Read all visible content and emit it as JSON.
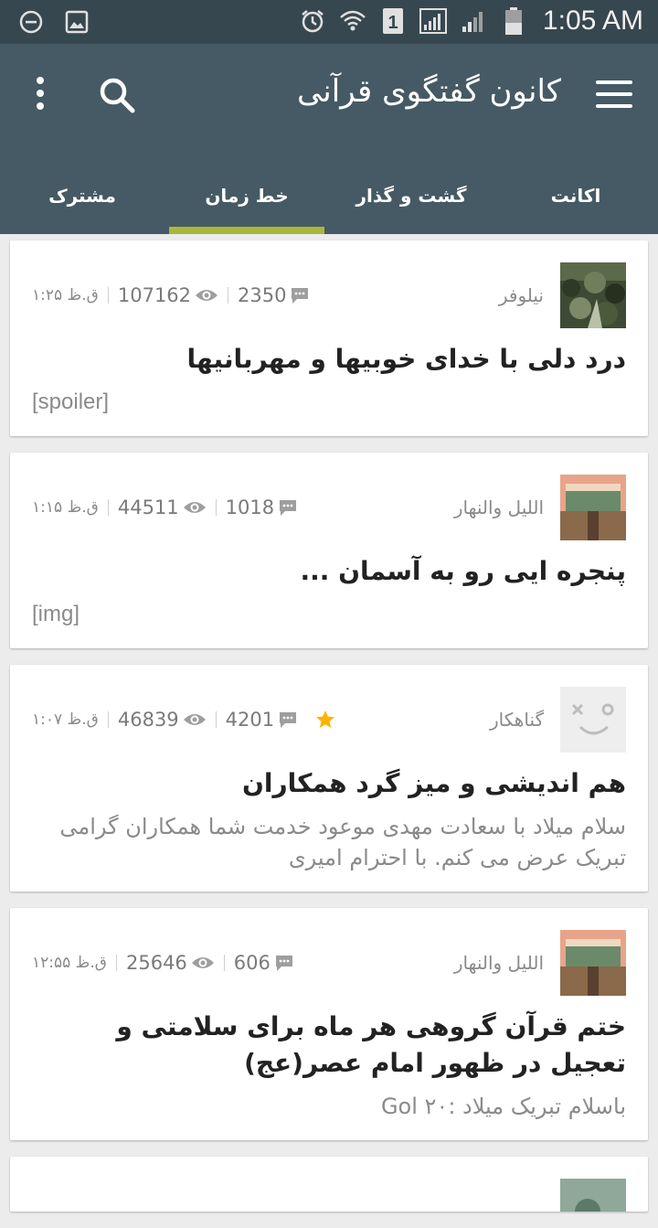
{
  "status_bar": {
    "time": "1:05 AM",
    "icons": [
      "do-not-disturb-icon",
      "gallery-icon",
      "alarm-icon",
      "wifi-icon",
      "sim-1-icon",
      "signal-icon",
      "signal-2-icon",
      "battery-icon"
    ]
  },
  "app_bar": {
    "title": "کانون گفتگوی قرآنی",
    "icons": [
      "menu-icon",
      "search-icon",
      "more-vert-icon"
    ],
    "tabs": [
      {
        "label": "اکانت",
        "active": false
      },
      {
        "label": "گشت و گذار",
        "active": false
      },
      {
        "label": "خط زمان",
        "active": true
      },
      {
        "label": "مشترک",
        "active": false
      }
    ],
    "colors": {
      "status": "#37474f",
      "bar": "#455a64",
      "indicator": "#a8b83a"
    }
  },
  "posts": [
    {
      "author": "نیلوفر",
      "comments": "2350",
      "views": "107162",
      "time": "۱:۲۵ ق.ظ",
      "title": "درد دلی با خدای خوبیها و مهربانیها",
      "body": "[spoiler]",
      "starred": false
    },
    {
      "author": "اللیل والنهار",
      "comments": "1018",
      "views": "44511",
      "time": "۱:۱۵ ق.ظ",
      "title": "پنجره ایی رو به آسمان ...",
      "body": "[img]",
      "starred": false
    },
    {
      "author": "گناهکار",
      "comments": "4201",
      "views": "46839",
      "time": "۱:۰۷ ق.ظ",
      "title": "هم اندیشی و میز گرد همکاران",
      "body": "سلام میلاد با سعادت مهدی موعود خدمت شما همکاران گرامی تبریک عرض می کنم. با احترام امیری",
      "starred": true
    },
    {
      "author": "اللیل والنهار",
      "comments": "606",
      "views": "25646",
      "time": "۱۲:۵۵ ق.ظ",
      "title": "ختم قرآن گروهی هر ماه برای سلامتی و تعجیل در ظهور امام عصر(عج)",
      "body": "باسلام تبریک میلاد :۲۰ Gol",
      "starred": false
    }
  ]
}
